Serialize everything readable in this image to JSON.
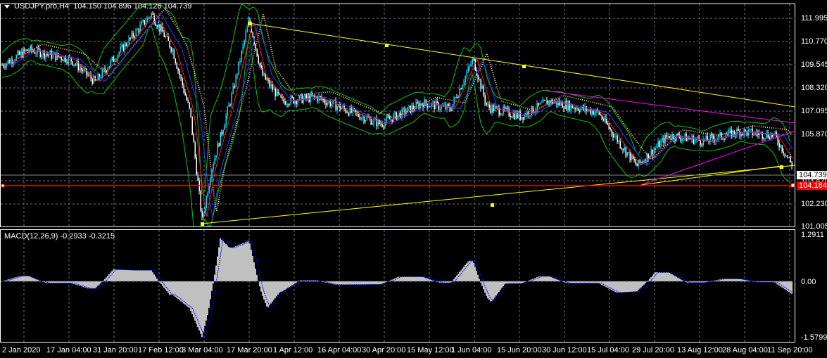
{
  "chart": {
    "symbol_line": "USDJPY.pro,H4",
    "ohlc": "104.150 104.896 104.126 104.739",
    "price_labels": [
      "111.995",
      "110.770",
      "109.545",
      "108.320",
      "107.095",
      "105.870",
      "103.420",
      "102.230",
      "101.005"
    ],
    "current_price": "104.739",
    "line_price": "104.184",
    "macd_label": "MACD(12,26,9) -0.2933 -0.3215",
    "macd_labels": [
      "1.2911",
      "0.00",
      "-1.5799"
    ],
    "date_labels": [
      "2 Jan 2020",
      "17 Jan 04:00",
      "31 Jan 20:00",
      "17 Feb 12:00",
      "3 Mar 04:00",
      "17 Mar 20:00",
      "1 Apr 12:00",
      "16 Apr 04:00",
      "30 Apr 20:00",
      "15 May 12:00",
      "1 Jun 04:00",
      "15 Jun 20:00",
      "30 Jun 12:00",
      "15 Jul 04:00",
      "29 Jul 20:00",
      "13 Aug 12:00",
      "28 Aug 04:00",
      "11 Sep 20:00"
    ],
    "colors": {
      "up": "#00e5ff",
      "down": "#ffffff",
      "trend": "#ffff00",
      "channel": "#ff00ff",
      "hline": "#ff0000",
      "envelope": "#00c800",
      "histogram": "#c0c0c0",
      "signal": "#0000ff"
    }
  }
}
